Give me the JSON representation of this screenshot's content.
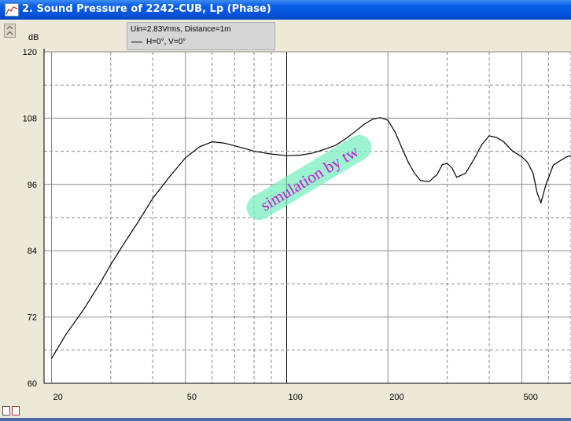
{
  "window": {
    "title": "2. Sound Pressure of 2242-CUB, Lp (Phase)"
  },
  "legend": {
    "line1": "Uin=2.83Vrms, Distance=1m",
    "line2": "H=0°, V=0°"
  },
  "watermark": {
    "text": "simulation by tw"
  },
  "chart_data": {
    "type": "line",
    "ylabel": "dB",
    "xscale": "log",
    "xlim": [
      19,
      700
    ],
    "ylim": [
      60,
      120
    ],
    "x_ticks": [
      20,
      50,
      100,
      200,
      500
    ],
    "x_tick_labels": [
      "20",
      "50",
      "100",
      "200",
      "500"
    ],
    "y_ticks": [
      60,
      72,
      84,
      96,
      108,
      120
    ],
    "y_tick_labels": [
      "60",
      "72",
      "84",
      "96",
      "108",
      "120"
    ],
    "grid": true,
    "series": [
      {
        "color": "#000000",
        "x": [
          20,
          22,
          25,
          28,
          30,
          33,
          36,
          40,
          45,
          50,
          55,
          60,
          65,
          70,
          75,
          80,
          90,
          100,
          110,
          120,
          130,
          140,
          150,
          160,
          170,
          180,
          190,
          200,
          210,
          220,
          230,
          240,
          250,
          265,
          280,
          290,
          300,
          310,
          320,
          340,
          360,
          380,
          400,
          420,
          440,
          470,
          500,
          520,
          540,
          555,
          570,
          590,
          620,
          650,
          680,
          700
        ],
        "y": [
          64.5,
          68.7,
          73.5,
          78.3,
          81.5,
          85.5,
          89.0,
          93.5,
          97.5,
          100.8,
          102.8,
          103.7,
          103.5,
          103.0,
          102.5,
          102.0,
          101.5,
          101.2,
          101.3,
          101.7,
          102.4,
          103.1,
          104.3,
          105.6,
          106.9,
          107.8,
          108.1,
          107.6,
          105.5,
          102.6,
          100.0,
          98.0,
          96.7,
          96.5,
          97.8,
          99.6,
          99.8,
          99.0,
          97.3,
          98.0,
          100.5,
          103.2,
          104.8,
          104.5,
          103.8,
          102.0,
          101.0,
          100.0,
          98.0,
          94.5,
          92.7,
          96.0,
          99.5,
          100.3,
          101.0,
          101.2
        ]
      }
    ]
  }
}
